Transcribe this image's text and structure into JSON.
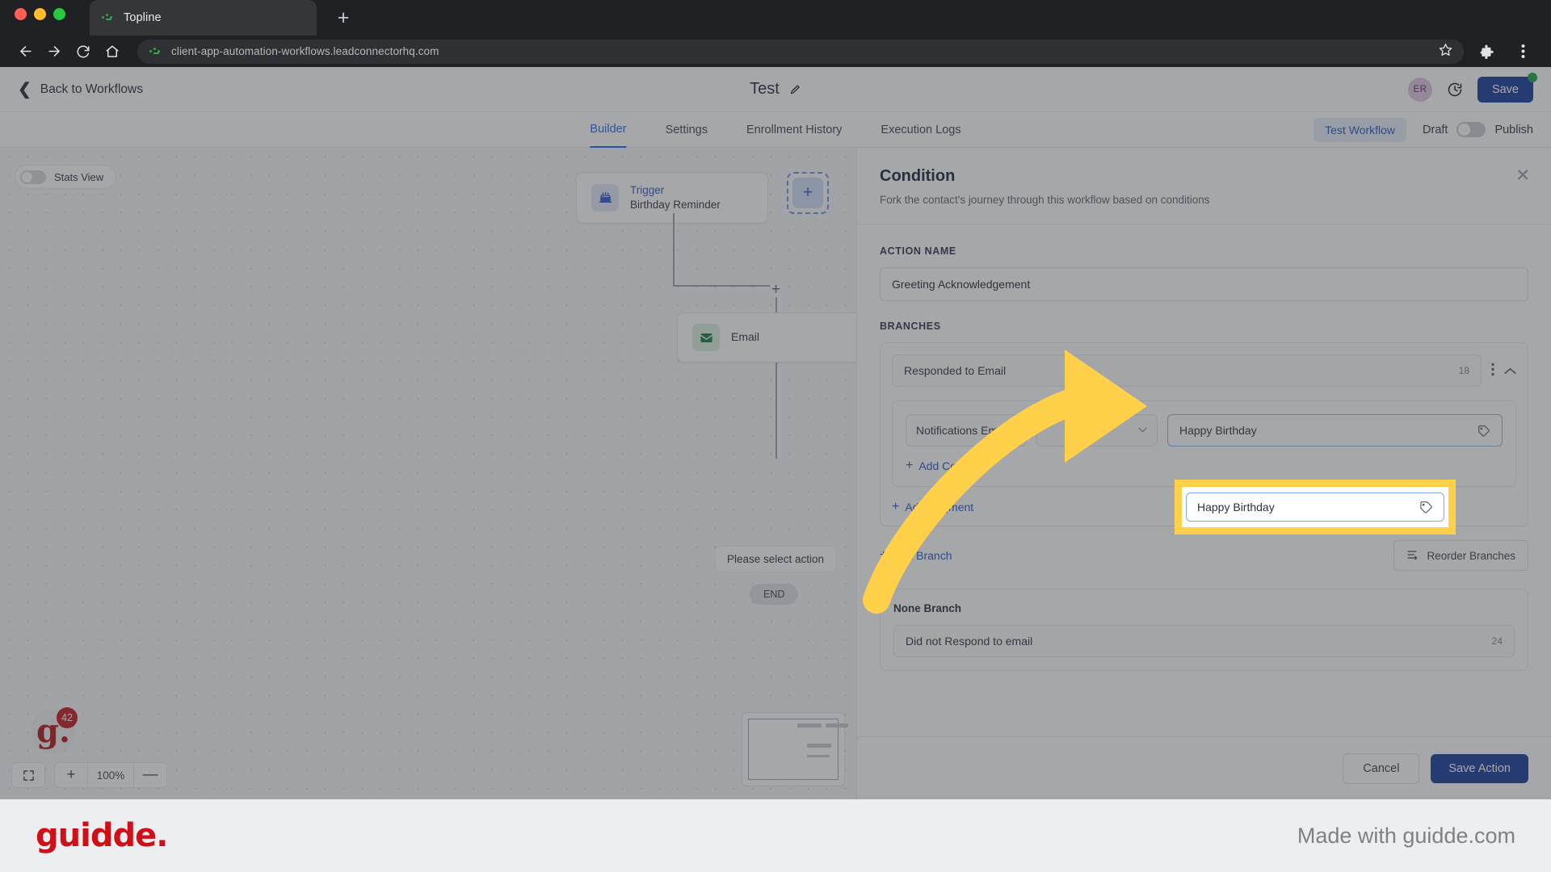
{
  "browser": {
    "tab_title": "Topline",
    "url": "client-app-automation-workflows.leadconnectorhq.com",
    "new_tab_label": "+",
    "icons": {
      "back": "back-arrow-icon",
      "forward": "forward-arrow-icon",
      "reload": "reload-icon",
      "home": "home-icon",
      "bookmark": "star-icon",
      "extensions": "puzzle-piece-icon",
      "menu": "kebab-menu-icon"
    }
  },
  "app_header": {
    "back_label": "Back to Workflows",
    "workflow_title": "Test",
    "avatar_initials": "ER",
    "save_label": "Save"
  },
  "tabs": {
    "items": [
      {
        "label": "Builder",
        "active": true
      },
      {
        "label": "Settings",
        "active": false
      },
      {
        "label": "Enrollment History",
        "active": false
      },
      {
        "label": "Execution Logs",
        "active": false
      }
    ],
    "test_workflow_label": "Test Workflow",
    "draft_label": "Draft",
    "publish_label": "Publish"
  },
  "canvas": {
    "stats_view_label": "Stats View",
    "trigger_node": {
      "title": "Trigger",
      "subtitle": "Birthday Reminder"
    },
    "email_node": {
      "title": "Email"
    },
    "select_action_text": "Please select action",
    "end_label": "END",
    "zoom_level": "100%",
    "zoom_in": "+",
    "zoom_out": "—",
    "guidde_badge_letter": "g.",
    "guidde_badge_count": "42"
  },
  "panel": {
    "title": "Condition",
    "subtitle": "Fork the contact's journey through this workflow based on conditions",
    "action_name_label": "ACTION NAME",
    "action_name_value": "Greeting Acknowledgement",
    "branches_label": "BRANCHES",
    "branch": {
      "name": "Responded to Email",
      "count": "18",
      "condition": {
        "field": "Notifications Email F...",
        "operator": "",
        "value": "Happy Birthday"
      },
      "add_condition_label": "Add Condition",
      "add_segment_label": "Add Segment"
    },
    "add_branch_label": "Add Branch",
    "reorder_branches_label": "Reorder Branches",
    "none_branch": {
      "title": "None Branch",
      "name": "Did not Respond to email",
      "count": "24"
    },
    "cancel_label": "Cancel",
    "save_action_label": "Save Action"
  },
  "highlight": {
    "value": "Happy Birthday",
    "border_color": "#ffd04a",
    "arrow_color": "#ffd04a"
  },
  "footer": {
    "brand": "guidde.",
    "made_with": "Made with guidde.com"
  }
}
